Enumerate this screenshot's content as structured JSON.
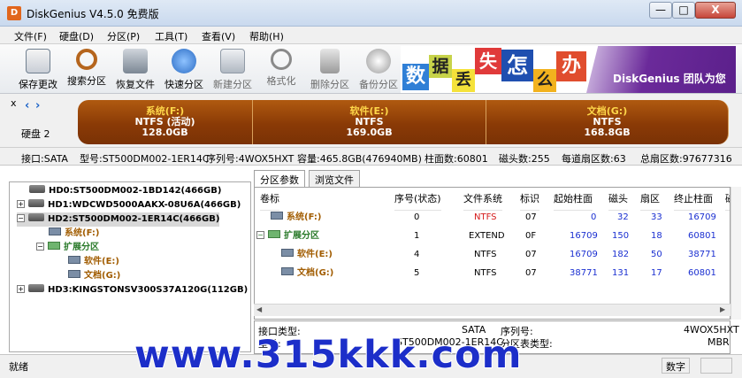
{
  "window": {
    "title": "DiskGenius V4.5.0 免费版",
    "app_icon": "D",
    "minimize": "—",
    "maximize": "□",
    "close": "X"
  },
  "menu": [
    "文件(F)",
    "硬盘(D)",
    "分区(P)",
    "工具(T)",
    "查看(V)",
    "帮助(H)"
  ],
  "toolbar": [
    {
      "label": "保存更改",
      "icon": "save-icon",
      "color": "#6f7f8f"
    },
    {
      "label": "搜索分区",
      "icon": "magnifier-icon",
      "color": "#b5651d"
    },
    {
      "label": "恢复文件",
      "icon": "restore-icon",
      "color": "#7b8794"
    },
    {
      "label": "快速分区",
      "icon": "quick-partition-icon",
      "color": "#2b6cc4"
    },
    {
      "label": "新建分区",
      "icon": "new-partition-icon",
      "color": "#909aa6"
    },
    {
      "label": "格式化",
      "icon": "format-icon",
      "color": "#8a8a8a"
    },
    {
      "label": "删除分区",
      "icon": "delete-partition-icon",
      "color": "#8a8a8a"
    },
    {
      "label": "备份分区",
      "icon": "backup-icon",
      "color": "#9a9a9a"
    }
  ],
  "banner": {
    "tiles": [
      {
        "text": "数",
        "bg": "#2f7fd6",
        "color": "#ffffff"
      },
      {
        "text": "据",
        "bg": "#c7d34a",
        "color": "#222222"
      },
      {
        "text": "丢",
        "bg": "#f5e23a",
        "color": "#222222"
      },
      {
        "text": "失",
        "bg": "#e03a3a",
        "color": "#ffffff"
      },
      {
        "text": "怎",
        "bg": "#1f4fb0",
        "color": "#ffffff"
      },
      {
        "text": "么",
        "bg": "#f2b21e",
        "color": "#222222"
      },
      {
        "text": "办",
        "bg": "#e04d2e",
        "color": "#ffffff"
      }
    ],
    "slogan": "DiskGenius 团队为您"
  },
  "disk_map": {
    "close": "x",
    "disk_label": "硬盘 2",
    "segments": [
      {
        "name": "系统(F:)",
        "fs": "NTFS (活动)",
        "size": "128.0GB"
      },
      {
        "name": "软件(E:)",
        "fs": "NTFS",
        "size": "169.0GB"
      },
      {
        "name": "文档(G:)",
        "fs": "NTFS",
        "size": "168.8GB"
      }
    ]
  },
  "disk_info": [
    "接口:SATA",
    "型号:ST500DM002-1ER14C",
    "序列号:4WOX5HXT",
    "容量:465.8GB(476940MB)",
    "柱面数:60801",
    "磁头数:255",
    "每道扇区数:63",
    "总扇区数:97677316"
  ],
  "tree": [
    {
      "label": "HD0:ST500DM002-1BD142(466GB)",
      "type": "disk"
    },
    {
      "label": "HD1:WDCWD5000AAKX-08U6A(466GB)",
      "type": "disk"
    },
    {
      "label": "HD2:ST500DM002-1ER14C(466GB)",
      "type": "disk",
      "selected": true
    },
    {
      "label": "系统(F:)",
      "type": "partition"
    },
    {
      "label": "扩展分区",
      "type": "extended"
    },
    {
      "label": "软件(E:)",
      "type": "partition"
    },
    {
      "label": "文档(G:)",
      "type": "partition"
    },
    {
      "label": "HD3:KINGSTONSV300S37A120G(112GB)",
      "type": "disk"
    }
  ],
  "tabs": [
    "分区参数",
    "浏览文件"
  ],
  "table": {
    "headers": [
      "卷标",
      "序号(状态)",
      "文件系统",
      "标识",
      "起始柱面",
      "磁头",
      "扇区",
      "终止柱面",
      "磁"
    ],
    "rows": [
      {
        "name": "系统(F:)",
        "index": "0",
        "fs": "NTFS",
        "id": "07",
        "start_cyl": "0",
        "head": "32",
        "sector": "33",
        "end_cyl": "16709"
      },
      {
        "name": "扩展分区",
        "index": "1",
        "fs": "EXTEND",
        "id": "0F",
        "start_cyl": "16709",
        "head": "150",
        "sector": "18",
        "end_cyl": "60801"
      },
      {
        "name": "软件(E:)",
        "index": "4",
        "fs": "NTFS",
        "id": "07",
        "start_cyl": "16709",
        "head": "182",
        "sector": "50",
        "end_cyl": "38771"
      },
      {
        "name": "文档(G:)",
        "index": "5",
        "fs": "NTFS",
        "id": "07",
        "start_cyl": "38771",
        "head": "131",
        "sector": "17",
        "end_cyl": "60801"
      }
    ]
  },
  "details": {
    "interface_label": "接口类型:",
    "interface_value": "SATA",
    "model_label": "型号:",
    "model_value": "ST500DM002-1ER14C",
    "serial_label": "序列号:",
    "serial_value": "4WOX5HXT",
    "pt_label": "分区表类型:",
    "pt_value": "MBR"
  },
  "status": {
    "ready": "就绪",
    "num": "数字"
  },
  "watermark": "www.315kkk.com"
}
